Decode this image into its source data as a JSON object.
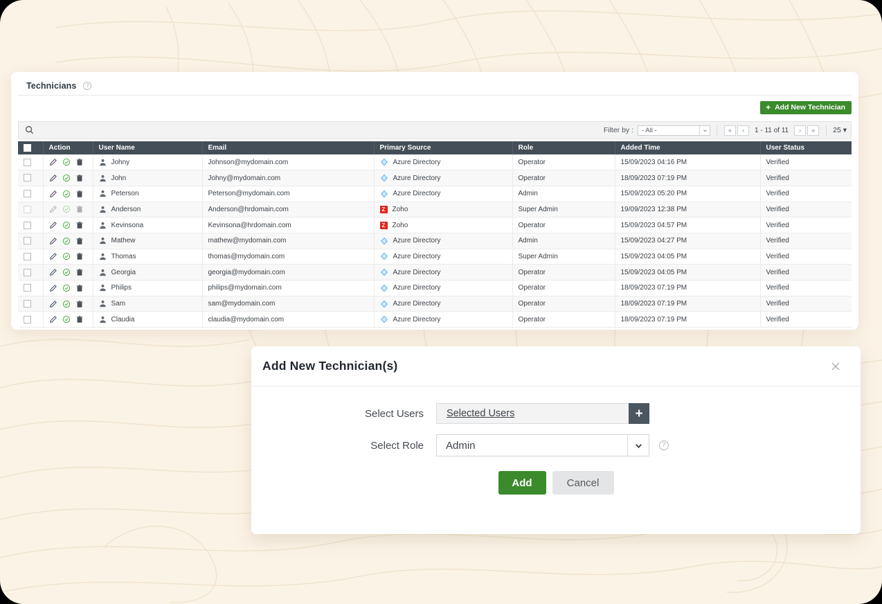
{
  "panel": {
    "title": "Technicians",
    "help_icon": "help-circle-icon",
    "add_button_label": "Add New Technician",
    "add_button_color": "#3b8a2c",
    "search_icon": "search-icon"
  },
  "filter": {
    "label": "Filter by :",
    "selected": "- All -",
    "first_label": "«",
    "prev_label": "‹",
    "range_text": "1 - 11 of 11",
    "next_label": "›",
    "last_label": "»",
    "page_size": "25 ▾"
  },
  "table": {
    "columns": [
      "Action",
      "User Name",
      "Email",
      "Primary Source",
      "Role",
      "Added Time",
      "User Status"
    ],
    "rows": [
      {
        "user": "Johny",
        "email": "Johnson@mydomain.com",
        "source": "Azure Directory",
        "source_icon": "azure-icon",
        "role": "Operator",
        "added": "15/09/2023 04:16 PM",
        "status": "Verified",
        "dimmed": false
      },
      {
        "user": "John",
        "email": "Johny@mydomain.com",
        "source": "Azure Directory",
        "source_icon": "azure-icon",
        "role": "Operator",
        "added": "18/09/2023 07:19 PM",
        "status": "Verified",
        "dimmed": false
      },
      {
        "user": "Peterson",
        "email": "Peterson@mydomain.com",
        "source": "Azure Directory",
        "source_icon": "azure-icon",
        "role": "Admin",
        "added": "15/09/2023 05:20 PM",
        "status": "Verified",
        "dimmed": false
      },
      {
        "user": "Anderson",
        "email": "Anderson@hrdomain.com",
        "source": "Zoho",
        "source_icon": "zoho-icon",
        "role": "Super Admin",
        "added": "19/09/2023 12:38 PM",
        "status": "Verified",
        "dimmed": true
      },
      {
        "user": "Kevinsona",
        "email": "Kevinsona@hrdomain.com",
        "source": "Zoho",
        "source_icon": "zoho-icon",
        "role": "Operator",
        "added": "15/09/2023 04:57 PM",
        "status": "Verified",
        "dimmed": false
      },
      {
        "user": "Mathew",
        "email": "mathew@mydomain.com",
        "source": "Azure Directory",
        "source_icon": "azure-icon",
        "role": "Admin",
        "added": "15/09/2023 04:27 PM",
        "status": "Verified",
        "dimmed": false
      },
      {
        "user": "Thomas",
        "email": "thomas@mydomain.com",
        "source": "Azure Directory",
        "source_icon": "azure-icon",
        "role": "Super Admin",
        "added": "15/09/2023 04:05 PM",
        "status": "Verified",
        "dimmed": false
      },
      {
        "user": "Georgia",
        "email": "georgia@mydomain.com",
        "source": "Azure Directory",
        "source_icon": "azure-icon",
        "role": "Operator",
        "added": "15/09/2023 04:05 PM",
        "status": "Verified",
        "dimmed": false
      },
      {
        "user": "Philips",
        "email": "philips@mydomain.com",
        "source": "Azure Directory",
        "source_icon": "azure-icon",
        "role": "Operator",
        "added": "18/09/2023 07:19 PM",
        "status": "Verified",
        "dimmed": false
      },
      {
        "user": "Sam",
        "email": "sam@mydomain.com",
        "source": "Azure Directory",
        "source_icon": "azure-icon",
        "role": "Operator",
        "added": "18/09/2023 07:19 PM",
        "status": "Verified",
        "dimmed": false
      },
      {
        "user": "Claudia",
        "email": "claudia@mydomain.com",
        "source": "Azure Directory",
        "source_icon": "azure-icon",
        "role": "Operator",
        "added": "18/09/2023 07:19 PM",
        "status": "Verified",
        "dimmed": false
      }
    ],
    "row_action_icons": [
      "edit-pencil-icon",
      "approve-check-icon",
      "delete-trash-icon"
    ],
    "header_bg": "#434e58",
    "zoho_badge_color": "#e1251b"
  },
  "modal": {
    "title": "Add New Technician(s)",
    "close_icon": "close-icon",
    "select_users_label": "Select Users",
    "select_users_value": "Selected Users",
    "add_user_icon": "plus-icon",
    "select_role_label": "Select Role",
    "select_role_value": "Admin",
    "role_caret_icon": "chevron-down-icon",
    "role_help_icon": "help-circle-icon",
    "add_label": "Add",
    "cancel_label": "Cancel",
    "add_color": "#3b8a2c"
  },
  "background": {
    "color": "#fbf3e6",
    "pattern": "topographic-contours"
  }
}
